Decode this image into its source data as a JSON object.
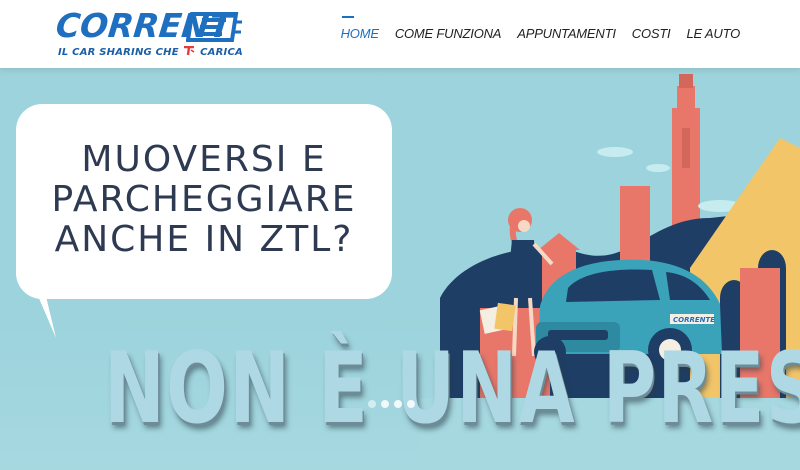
{
  "brand": {
    "logo_word": "CORRENT",
    "logo_badge": "E",
    "tagline_before": "IL CAR SHARING CHE",
    "tagline_after": "CARICA",
    "colors": {
      "primary": "#1e6fc0",
      "dark": "#1b5fa8",
      "accent_red": "#e63b3b"
    }
  },
  "nav": {
    "items": [
      {
        "label": "HOME",
        "active": true
      },
      {
        "label": "COME FUNZIONA",
        "active": false
      },
      {
        "label": "APPUNTAMENTI",
        "active": false
      },
      {
        "label": "COSTI",
        "active": false
      },
      {
        "label": "LE AUTO",
        "active": false
      }
    ]
  },
  "hero": {
    "bubble_lines": [
      "MUOVERSI E",
      "PARCHEGGIARE",
      "ANCHE IN ZTL?"
    ],
    "slogan": "NON È UNA PRESA!",
    "car_badge": "CORRENTE",
    "slides": 4,
    "active_slide": 1,
    "colors": {
      "sky": "#9dd3dc",
      "tower": "#e8776a",
      "building_yellow": "#f3c569",
      "hill_navy": "#1f3e66",
      "car": "#3aa3b9"
    }
  }
}
